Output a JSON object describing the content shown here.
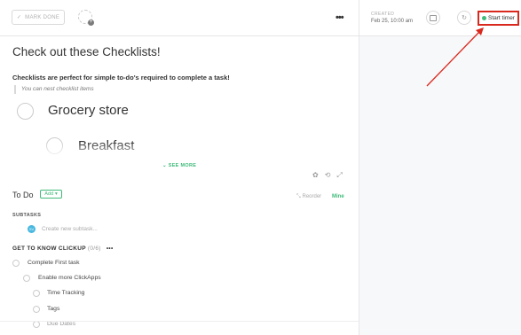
{
  "header": {
    "mark_done": "MARK DONE",
    "kebab": "•••",
    "created_label": "CREATED",
    "created_value": "Feb 25, 10:00 am",
    "start_timer": "Start timer"
  },
  "description": {
    "title": "Check out these Checklists!",
    "subheading": "Checklists are perfect for simple to-do's required to complete a task!",
    "quote": "You can nest checklist items",
    "items": [
      "Grocery store",
      "Breakfast"
    ],
    "see_more": "SEE MORE"
  },
  "todo": {
    "label": "To Do",
    "add": "Add",
    "reorder": "Reorder",
    "mine": "Mine",
    "subtasks_label": "SUBTASKS",
    "subtask_avatar": "SV",
    "subtask_placeholder": "Create new subtask...",
    "checklist_title": "GET TO KNOW CLICKUP",
    "checklist_count": "(0/6)",
    "checklist_menu": "•••",
    "checklist_items": [
      "Complete First task",
      "Enable more ClickApps",
      "Time Tracking",
      "Tags",
      "Due Dates"
    ]
  },
  "colors": {
    "accent": "#3fba7a",
    "highlight_border": "#d9291e",
    "arrow": "#d9291e"
  }
}
